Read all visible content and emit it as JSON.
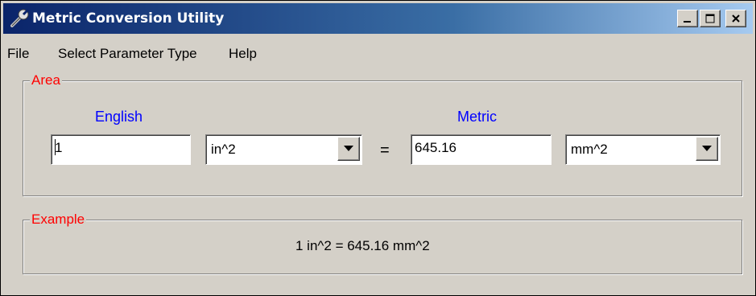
{
  "window": {
    "title": "Metric Conversion Utility",
    "icon": "wrench-icon",
    "controls": [
      "minimize-icon",
      "maximize-icon",
      "close-icon"
    ]
  },
  "menu": {
    "items": [
      {
        "label": "File"
      },
      {
        "label": "Select Parameter Type"
      },
      {
        "label": "Help"
      }
    ]
  },
  "area_group": {
    "label": "Area",
    "english_label": "English",
    "metric_label": "Metric",
    "english_value": "1",
    "english_unit": "in^2",
    "equals": "=",
    "metric_value": "645.16",
    "metric_unit": "mm^2"
  },
  "example_group": {
    "label": "Example",
    "text": "1 in^2 = 645.16 mm^2"
  },
  "colors": {
    "title_bar": "#0a246a",
    "group_label": "#ff0000",
    "column_label": "#0000ff",
    "window_bg": "#d4d0c8"
  }
}
